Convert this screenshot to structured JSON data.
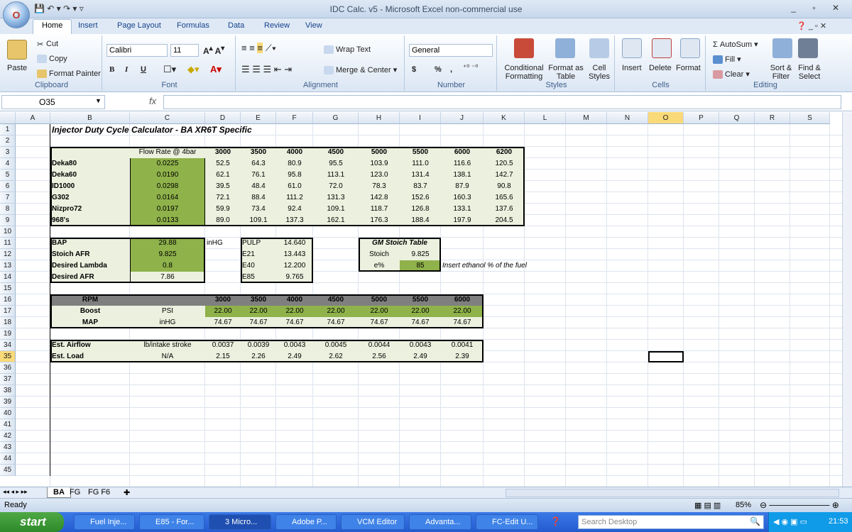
{
  "window": {
    "title": "IDC Calc. v5 - Microsoft Excel non-commercial use",
    "office_logo": "O",
    "controls": "_ ▫ ✕",
    "qat": "💾 ↶ ▾ ↷ ▾ ▿"
  },
  "ribbon_tabs": [
    "Home",
    "Insert",
    "Page Layout",
    "Formulas",
    "Data",
    "Review",
    "View"
  ],
  "ribbon": {
    "clipboard": {
      "label": "Clipboard",
      "paste": "Paste",
      "cut": "Cut",
      "copy": "Copy",
      "format_painter": "Format Painter"
    },
    "font": {
      "label": "Font",
      "family": "Calibri",
      "size": "11",
      "bold": "B",
      "italic": "I",
      "underline": "U"
    },
    "alignment": {
      "label": "Alignment",
      "wrap": "Wrap Text",
      "merge": "Merge & Center"
    },
    "number": {
      "label": "Number",
      "format": "General",
      "currency": "$",
      "percent": "%",
      "comma": ","
    },
    "styles": {
      "label": "Styles",
      "cond": "Conditional Formatting",
      "table": "Format as Table",
      "cell": "Cell Styles"
    },
    "cells": {
      "label": "Cells",
      "insert": "Insert",
      "delete": "Delete",
      "format": "Format"
    },
    "editing": {
      "label": "Editing",
      "autosum": "AutoSum",
      "fill": "Fill",
      "clear": "Clear",
      "sort": "Sort & Filter",
      "find": "Find & Select"
    }
  },
  "formula_bar": {
    "name_box": "O35",
    "fx": "fx",
    "value": ""
  },
  "columns": [
    "A",
    "B",
    "C",
    "D",
    "E",
    "F",
    "G",
    "H",
    "I",
    "J",
    "K",
    "L",
    "M",
    "N",
    "O",
    "P",
    "Q",
    "R",
    "S"
  ],
  "rows": [
    "1",
    "2",
    "3",
    "4",
    "5",
    "6",
    "7",
    "8",
    "9",
    "10",
    "11",
    "12",
    "13",
    "14",
    "15",
    "16",
    "17",
    "18",
    "19",
    "34",
    "35",
    "36",
    "37",
    "38",
    "39",
    "40",
    "41",
    "42",
    "43",
    "44",
    "45"
  ],
  "sheet": {
    "title": "Injector Duty Cycle Calculator - BA XR6T Specific",
    "inj_header": [
      "Flow Rate @ 4bar",
      "3000",
      "3500",
      "4000",
      "4500",
      "5000",
      "5500",
      "6000",
      "6200"
    ],
    "injectors": [
      {
        "name": "Deka80",
        "flow": "0.0225",
        "vals": [
          "52.5",
          "64.3",
          "80.9",
          "95.5",
          "103.9",
          "111.0",
          "116.6",
          "120.5"
        ]
      },
      {
        "name": "Deka60",
        "flow": "0.0190",
        "vals": [
          "62.1",
          "76.1",
          "95.8",
          "113.1",
          "123.0",
          "131.4",
          "138.1",
          "142.7"
        ]
      },
      {
        "name": "ID1000",
        "flow": "0.0298",
        "vals": [
          "39.5",
          "48.4",
          "61.0",
          "72.0",
          "78.3",
          "83.7",
          "87.9",
          "90.8"
        ]
      },
      {
        "name": "G302",
        "flow": "0.0164",
        "vals": [
          "72.1",
          "88.4",
          "111.2",
          "131.3",
          "142.8",
          "152.6",
          "160.3",
          "165.6"
        ]
      },
      {
        "name": "Nizpro72",
        "flow": "0.0197",
        "vals": [
          "59.9",
          "73.4",
          "92.4",
          "109.1",
          "118.7",
          "126.8",
          "133.1",
          "137.6"
        ]
      },
      {
        "name": "968's",
        "flow": "0.0133",
        "vals": [
          "89.0",
          "109.1",
          "137.3",
          "162.1",
          "176.3",
          "188.4",
          "197.9",
          "204.5"
        ]
      }
    ],
    "params": [
      {
        "label": "BAP",
        "value": "29.88",
        "unit": "inHG"
      },
      {
        "label": "Stoich AFR",
        "value": "9.825"
      },
      {
        "label": "Desired Lambda",
        "value": "0.8"
      },
      {
        "label": "Desired AFR",
        "value": "7.86"
      }
    ],
    "fuels": [
      {
        "name": "PULP",
        "val": "14.640"
      },
      {
        "name": "E21",
        "val": "13.443"
      },
      {
        "name": "E40",
        "val": "12.200"
      },
      {
        "name": "E85",
        "val": "9.765"
      }
    ],
    "gm": {
      "title": "GM Stoich Table",
      "stoich_label": "Stoich",
      "stoich_val": "9.825",
      "e_label": "e%",
      "e_val": "85",
      "note": "Insert ethanol % of the fuel"
    },
    "boost": {
      "rpm_label": "RPM",
      "rpm": [
        "3000",
        "3500",
        "4000",
        "4500",
        "5000",
        "5500",
        "6000"
      ],
      "boost_label": "Boost",
      "boost_unit": "PSI",
      "boost_vals": [
        "22.00",
        "22.00",
        "22.00",
        "22.00",
        "22.00",
        "22.00",
        "22.00"
      ],
      "map_label": "MAP",
      "map_unit": "inHG",
      "map_vals": [
        "74.67",
        "74.67",
        "74.67",
        "74.67",
        "74.67",
        "74.67",
        "74.67"
      ]
    },
    "est": {
      "airflow_label": "Est. Airflow",
      "airflow_unit": "lb/intake stroke",
      "airflow": [
        "0.0037",
        "0.0039",
        "0.0043",
        "0.0045",
        "0.0044",
        "0.0043",
        "0.0041"
      ],
      "load_label": "Est. Load",
      "load_unit": "N/A",
      "load": [
        "2.15",
        "2.26",
        "2.49",
        "2.62",
        "2.56",
        "2.49",
        "2.39"
      ]
    }
  },
  "sheet_tabs": [
    "BA",
    "FG",
    "FG F6"
  ],
  "sheet_nav": "◂◂ ◂ ▸ ▸▸",
  "status": {
    "ready": "Ready",
    "zoom": "85%"
  },
  "taskbar": {
    "start": "start",
    "items": [
      "Fuel Inje...",
      "E85 - For...",
      "3 Micro...",
      "Adobe P...",
      "VCM Editor",
      "Advanta...",
      "FC-Edit U..."
    ],
    "search": "Search Desktop",
    "clock": "21:53"
  }
}
